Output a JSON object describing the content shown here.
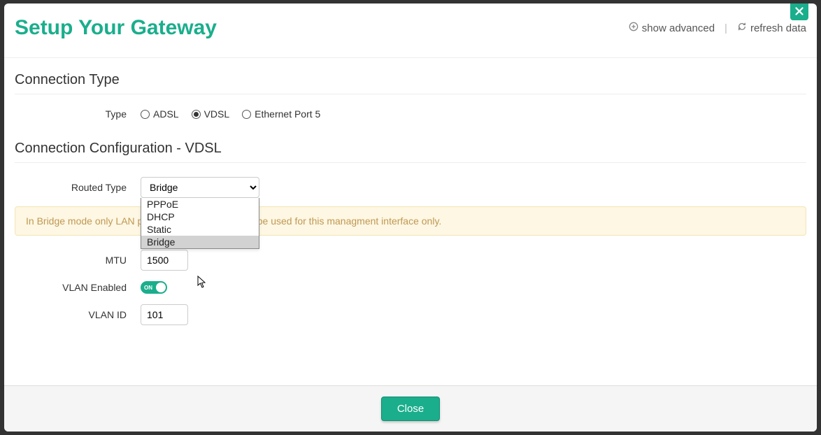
{
  "header": {
    "title": "Setup Your Gateway",
    "show_advanced": "show advanced",
    "refresh_data": "refresh data"
  },
  "section1": {
    "heading": "Connection Type",
    "type_label": "Type",
    "options": [
      "ADSL",
      "VDSL",
      "Ethernet Port 5"
    ],
    "selected": "VDSL"
  },
  "section2": {
    "heading": "Connection Configuration - VDSL",
    "routed_type_label": "Routed Type",
    "routed_type_value": "Bridge",
    "dropdown_options": [
      "PPPoE",
      "DHCP",
      "Static",
      "Bridge"
    ],
    "alert": "In Bridge mode only LAN port 4 and the wireless can be used for this managment interface only.",
    "mtu_label": "MTU",
    "mtu_value": "1500",
    "vlan_enabled_label": "VLAN Enabled",
    "vlan_enabled": "ON",
    "vlan_id_label": "VLAN ID",
    "vlan_id_value": "101"
  },
  "footer": {
    "close": "Close"
  }
}
